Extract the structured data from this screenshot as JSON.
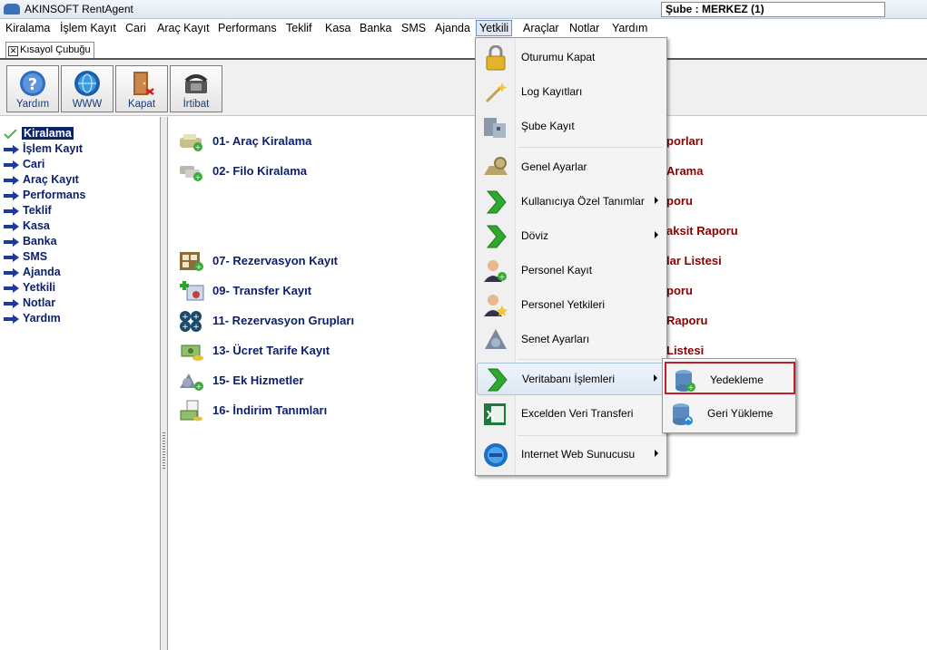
{
  "window": {
    "title": "AKINSOFT RentAgent",
    "branch": "Şube : MERKEZ (1)"
  },
  "menubar": [
    "Kiralama",
    "İşlem Kayıt",
    "Cari",
    "Araç Kayıt",
    "Performans",
    "Teklif",
    "Kasa",
    "Banka",
    "SMS",
    "Ajanda",
    "Yetkili",
    "Araçlar",
    "Notlar",
    "Yardım"
  ],
  "menubar_active": "Yetkili",
  "shortcut_tab": {
    "close": "✕",
    "label": "Kısayol Çubuğu"
  },
  "toolbar": [
    {
      "label": "Yardım",
      "icon": "help-icon"
    },
    {
      "label": "WWW",
      "icon": "globe-icon"
    },
    {
      "label": "Kapat",
      "icon": "exit-door-icon"
    },
    {
      "label": "İrtibat",
      "icon": "phone-icon"
    }
  ],
  "nav": [
    {
      "label": "Kiralama",
      "selected": true
    },
    {
      "label": "İşlem Kayıt"
    },
    {
      "label": "Cari"
    },
    {
      "label": "Araç Kayıt"
    },
    {
      "label": "Performans"
    },
    {
      "label": "Teklif"
    },
    {
      "label": "Kasa"
    },
    {
      "label": "Banka"
    },
    {
      "label": "SMS"
    },
    {
      "label": "Ajanda"
    },
    {
      "label": "Yetkili"
    },
    {
      "label": "Notlar"
    },
    {
      "label": "Yardım"
    }
  ],
  "operations": [
    {
      "label": "01- Araç Kiralama",
      "icon": "car-rental-icon"
    },
    {
      "label": "02- Filo Kiralama",
      "icon": "fleet-rental-icon"
    },
    {
      "label": "07- Rezervasyon Kayıt",
      "icon": "reservation-icon"
    },
    {
      "label": "09- Transfer Kayıt",
      "icon": "transfer-icon"
    },
    {
      "label": "11- Rezervasyon Grupları",
      "icon": "reservation-groups-icon"
    },
    {
      "label": "13- Ücret Tarife Kayıt",
      "icon": "fee-tariff-icon"
    },
    {
      "label": "15- Ek Hizmetler",
      "icon": "extra-services-icon"
    },
    {
      "label": "16- İndirim Tanımları",
      "icon": "discount-icon"
    }
  ],
  "right_column": [
    "porları",
    "Arama",
    "poru",
    "aksit Raporu",
    "lar Listesi",
    "poru",
    "Raporu",
    "Listesi"
  ],
  "dropdown": [
    {
      "label": "Oturumu Kapat",
      "icon": "lock-icon"
    },
    {
      "label": "Log Kayıtları",
      "icon": "magic-wand-icon"
    },
    {
      "label": "Şube Kayıt",
      "icon": "branch-icon"
    },
    {
      "label": "Genel Ayarlar",
      "icon": "settings-icon"
    },
    {
      "label": "Kullanıcıya Özel Tanımlar",
      "icon": "green-arrow-icon",
      "submenu": true
    },
    {
      "label": "Döviz",
      "icon": "green-arrow-icon",
      "submenu": true
    },
    {
      "label": "Personel Kayıt",
      "icon": "add-user-icon"
    },
    {
      "label": "Personel Yetkileri",
      "icon": "user-star-icon"
    },
    {
      "label": "Senet Ayarları",
      "icon": "note-icon"
    },
    {
      "label": "Veritabanı İşlemleri",
      "icon": "green-arrow-icon",
      "submenu": true,
      "hover": true
    },
    {
      "label": "Excelden Veri Transferi",
      "icon": "excel-icon"
    },
    {
      "label": "Internet Web Sunucusu",
      "icon": "web-server-icon",
      "submenu": true
    }
  ],
  "submenu": [
    {
      "label": "Yedekleme",
      "icon": "backup-database-icon",
      "highlighted": true
    },
    {
      "label": "Geri Yükleme",
      "icon": "restore-database-icon"
    }
  ],
  "colors": {
    "nav_text": "#0c1f6e",
    "report_text": "#8b0000",
    "highlight_border": "#c0202a",
    "selection": "#0a246a"
  }
}
